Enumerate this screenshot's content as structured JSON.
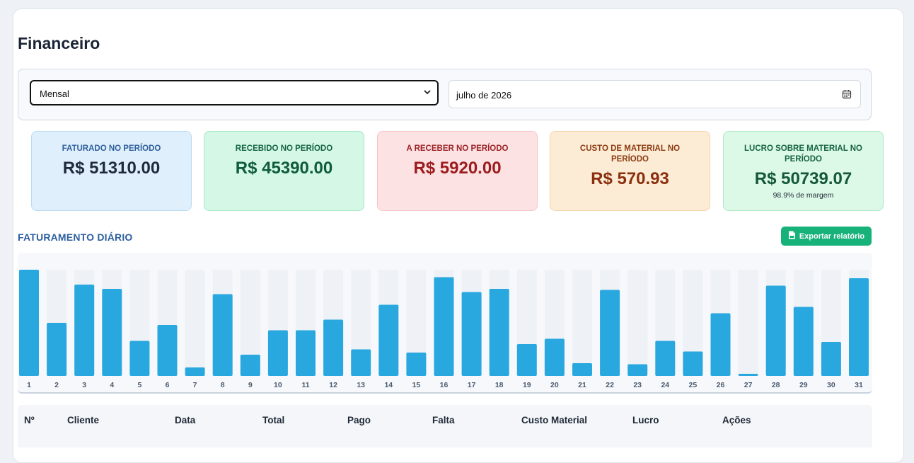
{
  "page": {
    "title": "Financeiro"
  },
  "filters": {
    "period_type": "Mensal",
    "period_value": "julho de 2026"
  },
  "stats": [
    {
      "label": "FATURADO NO PERÍODO",
      "value": "R$ 51310.00",
      "bg": "#dff0fc",
      "border": "#b9dbf3",
      "label_color": "#2f5f9e",
      "value_color": "#1f2a3c"
    },
    {
      "label": "RECEBIDO NO PERÍODO",
      "value": "R$ 45390.00",
      "bg": "#d5f7e6",
      "border": "#a6e8c6",
      "label_color": "#166444",
      "value_color": "#0f5c3c"
    },
    {
      "label": "A RECEBER NO PERÍODO",
      "value": "R$ 5920.00",
      "bg": "#fde2e4",
      "border": "#f6c3c7",
      "label_color": "#9b2226",
      "value_color": "#9b1c1c"
    },
    {
      "label": "CUSTO DE MATERIAL NO PERÍODO",
      "value": "R$ 570.93",
      "bg": "#fdecd5",
      "border": "#f5d4a8",
      "label_color": "#8a3b12",
      "value_color": "#8a2f0e"
    },
    {
      "label": "LUCRO SOBRE MATERIAL NO PERÍODO",
      "value": "R$ 50739.07",
      "sub": "98.9% de margem",
      "bg": "#dcf8e7",
      "border": "#aee9c5",
      "label_color": "#166444",
      "value_color": "#14573a"
    }
  ],
  "section": {
    "title": "FATURAMENTO DIÁRIO",
    "export_label": "Exportar relatório"
  },
  "chart_data": {
    "type": "bar",
    "categories": [
      "1",
      "2",
      "3",
      "4",
      "5",
      "6",
      "7",
      "8",
      "9",
      "10",
      "11",
      "12",
      "13",
      "14",
      "15",
      "16",
      "17",
      "18",
      "19",
      "20",
      "21",
      "22",
      "23",
      "24",
      "25",
      "26",
      "27",
      "28",
      "29",
      "30",
      "31"
    ],
    "values": [
      100,
      50,
      86,
      82,
      33,
      48,
      8,
      77,
      20,
      43,
      43,
      53,
      25,
      67,
      22,
      93,
      79,
      82,
      30,
      35,
      12,
      81,
      11,
      33,
      23,
      59,
      2,
      85,
      65,
      32,
      92
    ],
    "ylim": [
      0,
      100
    ],
    "color": "#29a8e0",
    "track_color": "#eef1f6",
    "grid": false
  },
  "table": {
    "headers": [
      "Nº",
      "Cliente",
      "Data",
      "Total",
      "Pago",
      "Falta",
      "Custo Material",
      "Lucro",
      "Ações"
    ]
  }
}
